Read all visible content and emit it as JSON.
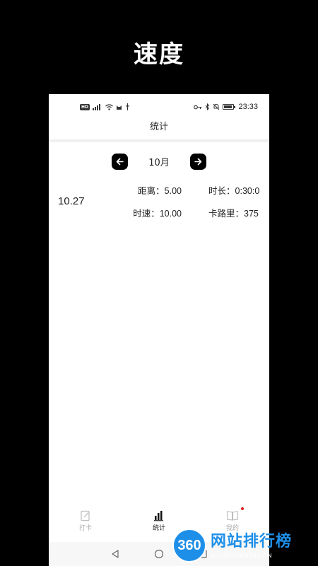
{
  "promo": {
    "title": "速度"
  },
  "status_bar": {
    "left_badge": "HD",
    "time": "23:33"
  },
  "header": {
    "title": "统计"
  },
  "month_nav": {
    "month": "10月",
    "prev_icon": "arrow-left-icon",
    "next_icon": "arrow-right-icon"
  },
  "records": [
    {
      "date": "10.27",
      "distance_label": "距离：",
      "distance": "5.00",
      "duration_label": "时长：",
      "duration": "0:30:0",
      "speed_label": "时速：",
      "speed": "10.00",
      "calories_label": "卡路里：",
      "calories": "375"
    }
  ],
  "tabs": [
    {
      "label": "打卡",
      "icon": "edit-note-icon",
      "active": false
    },
    {
      "label": "统计",
      "icon": "bar-chart-icon",
      "active": true
    },
    {
      "label": "我的",
      "icon": "book-icon",
      "active": false,
      "badge": true
    }
  ],
  "watermark": {
    "logo": "360",
    "cn": "网站排行榜",
    "en": "WANGZHAN360.CN"
  },
  "colors": {
    "background": "#000000",
    "accent_dark": "#000000",
    "badge_red": "#e02020",
    "watermark_blue": "#1e8fe8"
  }
}
